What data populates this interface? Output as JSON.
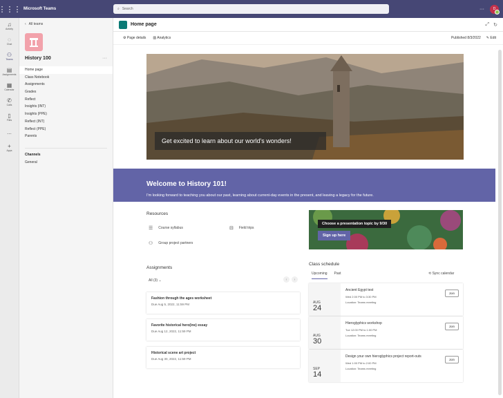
{
  "app": {
    "title": "Microsoft Teams",
    "search_placeholder": "Search",
    "more": "···",
    "avatar_initials": "D"
  },
  "rail": [
    {
      "label": "Activity",
      "icon": "bell-icon"
    },
    {
      "label": "Chat",
      "icon": "chat-icon"
    },
    {
      "label": "Teams",
      "icon": "teams-icon"
    },
    {
      "label": "Assignments",
      "icon": "assignments-icon"
    },
    {
      "label": "Calendar",
      "icon": "calendar-icon"
    },
    {
      "label": "Calls",
      "icon": "phone-icon"
    },
    {
      "label": "Files",
      "icon": "file-icon"
    },
    {
      "label": "...",
      "icon": "more-icon"
    },
    {
      "label": "Apps",
      "icon": "plus-icon"
    }
  ],
  "sidebar": {
    "back": "All teams",
    "team_name": "History 100",
    "team_more": "···",
    "items": [
      "Home page",
      "Class Notebook",
      "Assignments",
      "Grades",
      "Reflect",
      "Insights (INT)",
      "Insights (PPE)",
      "Reflect (INT)",
      "Reflect (PPE)",
      "Parents"
    ],
    "channels_header": "Channels",
    "channels": [
      "General"
    ]
  },
  "header": {
    "title": "Home page",
    "page_details": "Page details",
    "analytics": "Analytics",
    "published": "Published 8/3/2022",
    "edit": "Edit"
  },
  "hero": {
    "caption": "Get excited to learn about our world's wonders!"
  },
  "welcome": {
    "title": "Welcome to History 101!",
    "text": "I'm looking forward to teaching you about our past, learning about current-day events in the present, and leaving a legacy for the future."
  },
  "resources": {
    "title": "Resources",
    "items": [
      "Course syllabus",
      "Field trips",
      "Group project partners"
    ]
  },
  "promo": {
    "text": "Choose a presentation topic by 9/30",
    "button": "Sign up here"
  },
  "assignments": {
    "title": "Assignments",
    "filter": "All (3)",
    "prev": "‹",
    "next": "›",
    "items": [
      {
        "title": "Fashion through the ages worksheet",
        "due": "Due Aug 5, 2022, 11:59 PM"
      },
      {
        "title": "Favorite historical hero(ine) essay",
        "due": "Due Aug 12, 2022, 11:59 PM"
      },
      {
        "title": "Historical scene art project",
        "due": "Due Aug 30, 2022, 11:59 PM"
      }
    ]
  },
  "schedule": {
    "title": "Class schedule",
    "tabs": [
      "Upcoming",
      "Past"
    ],
    "sync": "Sync calendar",
    "events": [
      {
        "month": "AUG",
        "day": "24",
        "title": "Ancient Egypt test",
        "time": "Wed 2:00 PM to 3:30 PM",
        "location": "Location: Teams meeting",
        "join": "Join"
      },
      {
        "month": "AUG",
        "day": "30",
        "title": "Hieroglyphics workshop",
        "time": "Tue 12:00 PM to 1:00 PM",
        "location": "Location: Teams meeting",
        "join": "Join"
      },
      {
        "month": "SEP",
        "day": "14",
        "title": "Design your own hieroglyphics project report-outs",
        "time": "Wed 1:00 PM to 2:00 PM",
        "location": "Location: Teams meeting",
        "join": "Join"
      }
    ]
  }
}
